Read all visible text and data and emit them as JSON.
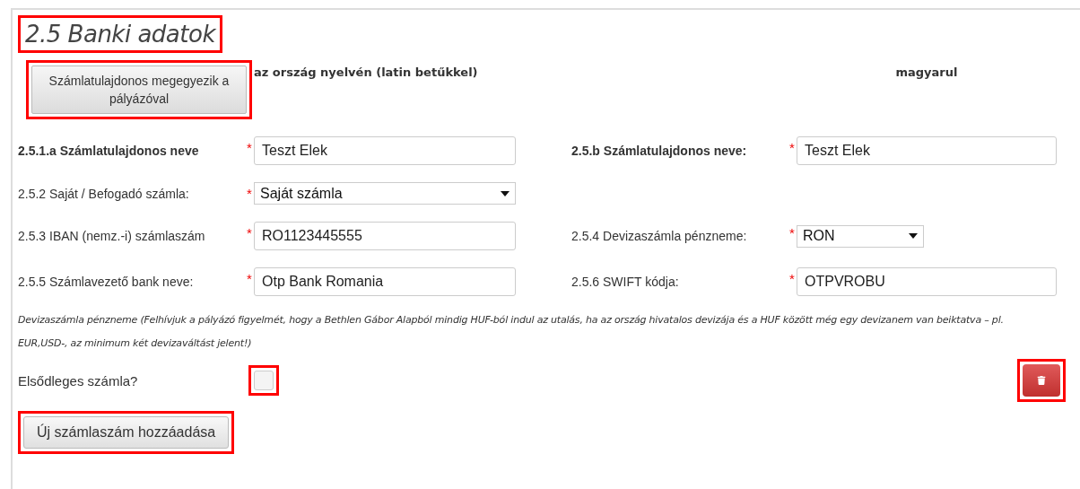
{
  "section": {
    "title": "2.5 Banki adatok",
    "highlighted": true
  },
  "owner_button": {
    "label": "Számlatulajdonos megegyezik a pályázóval",
    "highlighted": true
  },
  "column_headers": [
    "az ország nyelvén (latin betűkkel)",
    "magyarul"
  ],
  "rows": [
    {
      "left": {
        "label": "2.5.1.a Számlatulajdonos neve",
        "bold": true,
        "marker": "*",
        "kind": "text",
        "value": "Teszt Elek"
      },
      "right": {
        "label": "2.5.b Számlatulajdonos neve:",
        "bold": true,
        "marker": "*",
        "kind": "text",
        "value": "Teszt Elek"
      }
    },
    {
      "left": {
        "label": "2.5.2 Saját / Befogadó számla:",
        "bold": false,
        "marker": "*",
        "kind": "select",
        "value": "Saját számla"
      }
    },
    {
      "left": {
        "label": "2.5.3 IBAN (nemz.-i) számlaszám",
        "bold": false,
        "marker": "*",
        "kind": "text",
        "value": "RO1123445555"
      },
      "right": {
        "label": "2.5.4 Devizaszámla pénzneme:",
        "bold": false,
        "marker": "*",
        "kind": "select_short",
        "value": "RON"
      }
    },
    {
      "left": {
        "label": "2.5.5 Számlavezető bank neve:",
        "bold": false,
        "marker": "*",
        "kind": "text",
        "value": "Otp Bank Romania"
      },
      "right": {
        "label": "2.5.6 SWIFT kódja:",
        "bold": false,
        "marker": "*",
        "kind": "text",
        "value": "OTPVROBU"
      }
    }
  ],
  "note": "Devizaszámla pénzneme (Felhívjuk a pályázó figyelmét, hogy a Bethlen Gábor Alapból mindig HUF-ból indul az utalás, ha az ország hivatalos devizája és a HUF között még egy devizanem van beiktatva – pl. EUR,USD-, az minimum két devizaváltást jelent!)",
  "primary": {
    "label": "Elsődleges számla?",
    "checked": false,
    "highlighted": true
  },
  "delete_button": {
    "highlighted": true
  },
  "add_button": {
    "label": "Új számlaszám hozzáadása",
    "highlighted": true
  }
}
